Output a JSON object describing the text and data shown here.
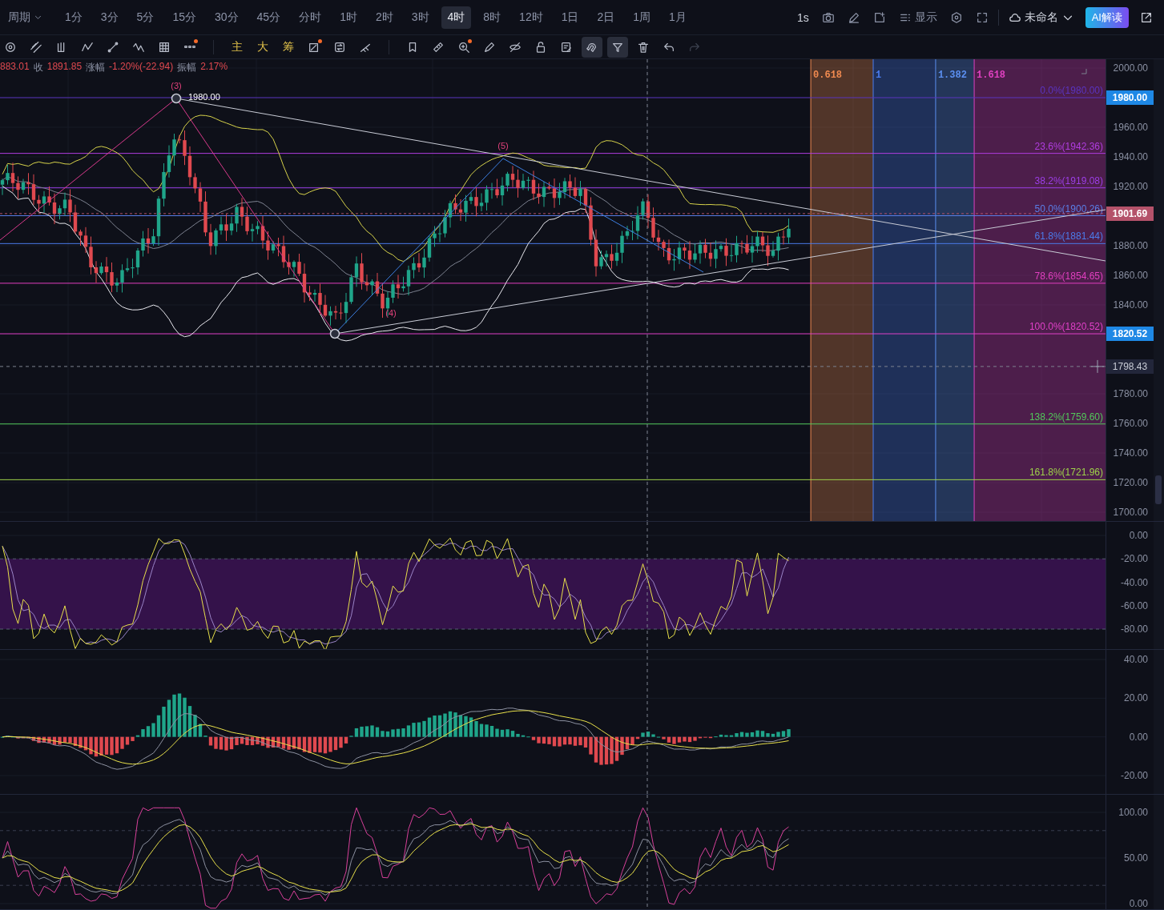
{
  "toolbar": {
    "period_label": "周期",
    "intervals": [
      {
        "label": "1分",
        "selected": false
      },
      {
        "label": "3分",
        "selected": false
      },
      {
        "label": "5分",
        "selected": false
      },
      {
        "label": "15分",
        "selected": false
      },
      {
        "label": "30分",
        "selected": false
      },
      {
        "label": "45分",
        "selected": false
      },
      {
        "label": "分时",
        "selected": false
      },
      {
        "label": "1时",
        "selected": false
      },
      {
        "label": "2时",
        "selected": false
      },
      {
        "label": "3时",
        "selected": false
      },
      {
        "label": "4时",
        "selected": true
      },
      {
        "label": "8时",
        "selected": false
      },
      {
        "label": "12时",
        "selected": false
      },
      {
        "label": "1日",
        "selected": false
      },
      {
        "label": "2日",
        "selected": false
      },
      {
        "label": "1周",
        "selected": false
      },
      {
        "label": "1月",
        "selected": false
      }
    ],
    "refresh_rate": "1s",
    "display_button": "显示",
    "layout_name": "未命名",
    "ai_button": "AI解读"
  },
  "drawing_tools": [
    {
      "kind": "target",
      "selected": false,
      "badge": false,
      "disabled": false
    },
    {
      "kind": "parallel",
      "selected": false,
      "badge": false,
      "disabled": false
    },
    {
      "kind": "pitchfork",
      "selected": false,
      "badge": false,
      "disabled": false
    },
    {
      "kind": "zigzag",
      "selected": false,
      "badge": false,
      "disabled": false
    },
    {
      "kind": "trendline",
      "selected": false,
      "badge": false,
      "disabled": false
    },
    {
      "kind": "wave",
      "selected": false,
      "badge": false,
      "disabled": false
    },
    {
      "kind": "grid",
      "selected": false,
      "badge": false,
      "disabled": false
    },
    {
      "kind": "more",
      "selected": false,
      "badge": true,
      "disabled": false
    },
    {
      "kind": "text",
      "label": "主",
      "selected": false,
      "badge": false,
      "disabled": false
    },
    {
      "kind": "text",
      "label": "大",
      "selected": false,
      "badge": false,
      "disabled": false
    },
    {
      "kind": "text",
      "label": "筹",
      "selected": false,
      "badge": false,
      "disabled": false
    },
    {
      "kind": "crop",
      "selected": false,
      "badge": true,
      "disabled": false
    },
    {
      "kind": "swap",
      "selected": false,
      "badge": false,
      "disabled": false
    },
    {
      "kind": "measure",
      "selected": false,
      "badge": false,
      "disabled": false
    },
    {
      "kind": "bookmark",
      "selected": false,
      "badge": false,
      "disabled": false
    },
    {
      "kind": "ruler",
      "selected": false,
      "badge": false,
      "disabled": false
    },
    {
      "kind": "zoom",
      "selected": false,
      "badge": true,
      "disabled": false
    },
    {
      "kind": "pen",
      "selected": false,
      "badge": false,
      "disabled": false
    },
    {
      "kind": "hide",
      "selected": false,
      "badge": false,
      "disabled": false
    },
    {
      "kind": "lock",
      "selected": false,
      "badge": false,
      "disabled": false
    },
    {
      "kind": "edit",
      "selected": false,
      "badge": false,
      "disabled": false
    },
    {
      "kind": "magnet",
      "selected": true,
      "badge": false,
      "disabled": false
    },
    {
      "kind": "filter",
      "selected": true,
      "badge": false,
      "disabled": false
    },
    {
      "kind": "trash",
      "selected": false,
      "badge": false,
      "disabled": false
    },
    {
      "kind": "undo",
      "selected": false,
      "badge": false,
      "disabled": false
    },
    {
      "kind": "redo",
      "selected": false,
      "badge": false,
      "disabled": true
    }
  ],
  "quote": {
    "cut_value": "883.01",
    "fields": [
      {
        "label": "收",
        "value": "1891.85"
      },
      {
        "label": "涨幅",
        "value": "-1.20%(-22.94)"
      },
      {
        "label": "振幅",
        "value": "2.17%"
      }
    ]
  },
  "main_chart": {
    "axis_ticks": [
      "2000.00",
      "1960.00",
      "1940.00",
      "1920.00",
      "1880.00",
      "1860.00",
      "1840.00",
      "1780.00",
      "1760.00",
      "1740.00",
      "1720.00",
      "1700.00"
    ],
    "price_tags": [
      {
        "text": "1980.00",
        "kind": "high"
      },
      {
        "text": "1901.69",
        "kind": "last"
      },
      {
        "text": "1820.52",
        "kind": "low"
      },
      {
        "text": "1798.43",
        "kind": "cursor"
      }
    ],
    "fib_levels": [
      {
        "label": "0.0%(1980.00)",
        "color": "#5a34c0"
      },
      {
        "label": "23.6%(1942.36)",
        "color": "#b13de0"
      },
      {
        "label": "38.2%(1919.08)",
        "color": "#9c3ee6"
      },
      {
        "label": "50.0%(1900.26)",
        "color": "#5a7ee6"
      },
      {
        "label": "61.8%(1881.44)",
        "color": "#4b7bea"
      },
      {
        "label": "78.6%(1854.65)",
        "color": "#e23fc0"
      },
      {
        "label": "100.0%(1820.52)",
        "color": "#e040c8"
      },
      {
        "label": "138.2%(1759.60)",
        "color": "#52c85a"
      },
      {
        "label": "161.8%(1721.96)",
        "color": "#9ed24a"
      }
    ],
    "time_zones": [
      {
        "label": "0.618",
        "color": "#f08a50"
      },
      {
        "label": "1",
        "color": "#4a7cf0"
      },
      {
        "label": "1.382",
        "color": "#5b8ff0"
      },
      {
        "label": "1.618",
        "color": "#e040c0"
      }
    ],
    "wave_labels": [
      "(3)",
      "(5)",
      "(4)"
    ],
    "point_label": "1980.00"
  },
  "indicators": [
    {
      "kind": "wr",
      "ticks": [
        "0.00",
        "-20.00",
        "-40.00",
        "-60.00",
        "-80.00"
      ]
    },
    {
      "kind": "macd",
      "ticks": [
        "40.00",
        "20.00",
        "0.00",
        "-20.00"
      ]
    },
    {
      "kind": "kdj",
      "ticks": [
        "100.00",
        "50.00",
        "0.00"
      ]
    }
  ]
}
